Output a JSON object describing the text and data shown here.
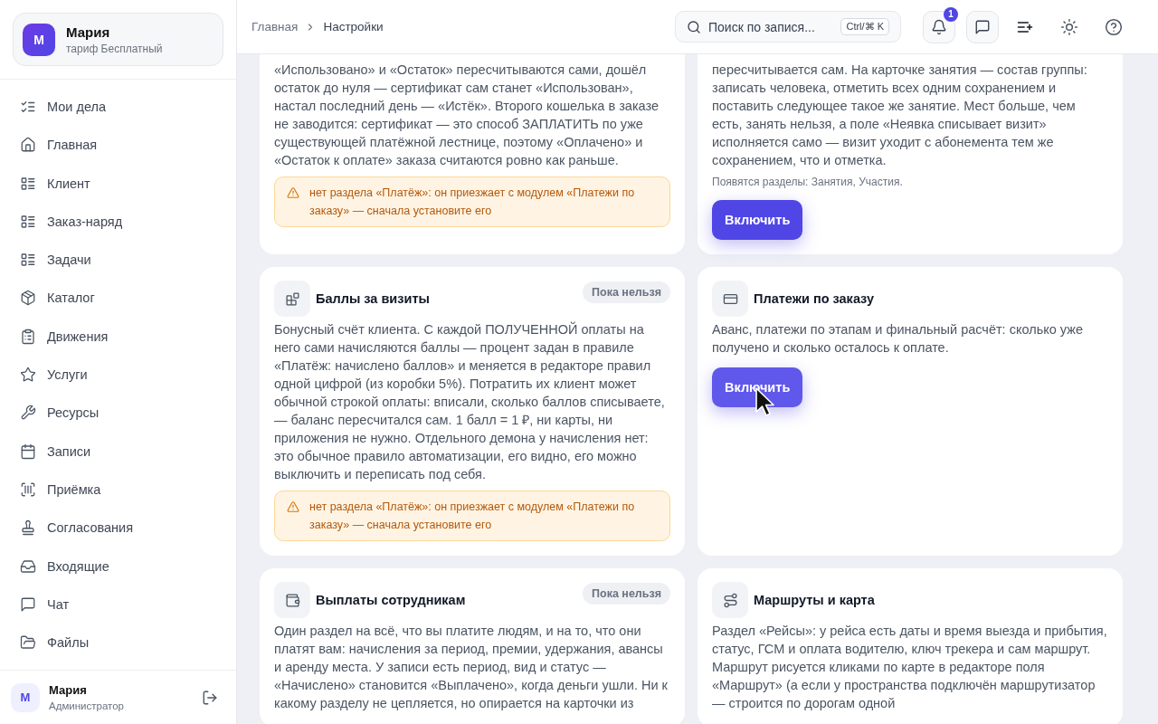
{
  "sidebar": {
    "profile": {
      "avatar": "М",
      "name": "Мария",
      "plan": "тариф Бесплатный"
    },
    "nav": [
      {
        "label": "Мои дела",
        "selected": false
      },
      {
        "label": "Главная",
        "selected": false
      },
      {
        "label": "Клиент",
        "selected": false
      },
      {
        "label": "Заказ-наряд",
        "selected": false
      },
      {
        "label": "Задачи",
        "selected": false
      },
      {
        "label": "Каталог",
        "selected": false
      },
      {
        "label": "Движения",
        "selected": false
      },
      {
        "label": "Услуги",
        "selected": false
      },
      {
        "label": "Ресурсы",
        "selected": false
      },
      {
        "label": "Записи",
        "selected": false
      },
      {
        "label": "Приёмка",
        "selected": false
      },
      {
        "label": "Согласования",
        "selected": false
      },
      {
        "label": "Входящие",
        "selected": false
      },
      {
        "label": "Чат",
        "selected": false
      },
      {
        "label": "Файлы",
        "selected": false
      }
    ],
    "user": {
      "avatar": "М",
      "name": "Мария",
      "role": "Администратор"
    }
  },
  "header": {
    "breadcrumbs": [
      "Главная",
      "Настройки"
    ],
    "search": {
      "placeholder": "Поиск по запися...",
      "shortcut": "Ctrl/⌘ K"
    },
    "notification_count": "1"
  },
  "modules": [
    {
      "description": "«Использовано» и «Остаток» пересчитываются сами, дошёл остаток до нуля — сертификат сам станет «Использован», настал последний день — «Истёк». Второго кошелька в заказе не заводится: сертификат — это способ ЗАПЛАТИТЬ по уже существующей платёжной лестнице, поэтому «Оплачено» и «Остаток к оплате» заказа считаются ровно как раньше.",
      "warning": "нет раздела «Платёж»: он приезжает с модулем «Платежи по заказу» — сначала установите его"
    },
    {
      "description": "пересчитывается сам. На карточке занятия — состав группы: записать человека, отметить всех одним сохранением и поставить следующее такое же занятие. Мест больше, чем есть, занять нельзя, а поле «Неявка списывает визит» исполняется само — визит уходит с абонемента тем же сохранением, что и отметка.",
      "note": "Появятся разделы: Занятия, Участия.",
      "button": {
        "label": "Включить",
        "hovered": false
      }
    },
    {
      "title": "Баллы за визиты",
      "badge": "Пока нельзя",
      "description": "Бонусный счёт клиента. С каждой ПОЛУЧЕННОЙ оплаты на него сами начисляются баллы — процент задан в правиле «Платёж: начислено баллов» и меняется в редакторе правил одной цифрой (из коробки 5%). Потратить их клиент может обычной строкой оплаты: вписали, сколько баллов списываете, — баланс пересчитался сам. 1 балл = 1 ₽, ни карты, ни приложения не нужно. Отдельного демона у начисления нет: это обычное правило автоматизации, его видно, его можно выключить и переписать под себя.",
      "warning": "нет раздела «Платёж»: он приезжает с модулем «Платежи по заказу» — сначала установите его"
    },
    {
      "title": "Платежи по заказу",
      "description": "Аванс, платежи по этапам и финальный расчёт: сколько уже получено и сколько осталось к оплате.",
      "button": {
        "label": "Включить",
        "hovered": true
      }
    },
    {
      "title": "Выплаты сотрудникам",
      "badge": "Пока нельзя",
      "description": "Один раздел на всё, что вы платите людям, и на то, что они платят вам: начисления за период, премии, удержания, авансы и аренду места. У записи есть период, вид и статус — «Начислено» становится «Выплачено», когда деньги ушли. Ни к какому разделу не цепляется, но опирается на карточки из"
    },
    {
      "title": "Маршруты и карта",
      "description": "Раздел «Рейсы»: у рейса есть даты и время выезда и прибытия, статус, ГСМ и оплата водителю, ключ трекера и сам маршрут. Маршрут рисуется кликами по карте в редакторе поля «Маршрут» (а если у пространства подключён маршрутизатор — строится по дорогам одной"
    }
  ]
}
